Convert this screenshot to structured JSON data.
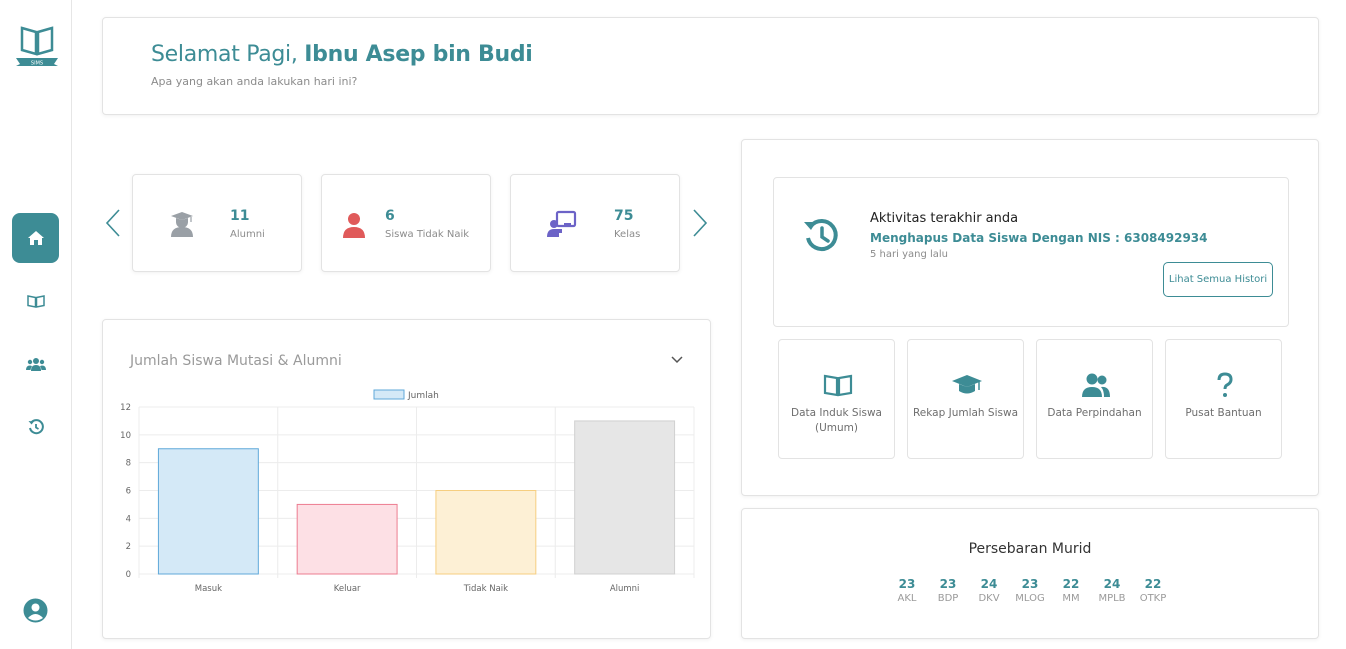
{
  "sidebar": {
    "logo_text": "SIMS",
    "items": [
      {
        "icon": "home-icon",
        "active": true
      },
      {
        "icon": "book-icon",
        "active": false
      },
      {
        "icon": "users-icon",
        "active": false
      },
      {
        "icon": "history-icon",
        "active": false
      }
    ],
    "profile_icon": "user-circle-icon"
  },
  "welcome": {
    "greeting": "Selamat Pagi, ",
    "name": "Ibnu Asep bin Budi",
    "subtitle": "Apa yang akan anda lakukan hari ini?"
  },
  "stats": [
    {
      "value": "11",
      "label": "Alumni",
      "icon": "graduate-icon",
      "color": "#9aa0a6"
    },
    {
      "value": "6",
      "label": "Siswa Tidak Naik",
      "icon": "user-icon",
      "color": "#e05a5a"
    },
    {
      "value": "75",
      "label": "Kelas",
      "icon": "classroom-icon",
      "color": "#6c63c7"
    }
  ],
  "chart_card": {
    "title": "Jumlah Siswa Mutasi & Alumni"
  },
  "chart_data": {
    "type": "bar",
    "categories": [
      "Masuk",
      "Keluar",
      "Tidak Naik",
      "Alumni"
    ],
    "series": [
      {
        "name": "Jumlah",
        "values": [
          9,
          5,
          6,
          11
        ]
      }
    ],
    "ylim": [
      0,
      12
    ],
    "yticks": [
      "0",
      "2",
      "4",
      "6",
      "8",
      "10",
      "12"
    ],
    "legend_position": "top",
    "grid": true,
    "colors": {
      "fills": [
        "#d4e9f7",
        "#fde0e5",
        "#fdf0d5",
        "#e6e6e6"
      ],
      "strokes": [
        "#5fa8d9",
        "#ec7c90",
        "#f6ce80",
        "#d0d0d0"
      ]
    }
  },
  "activity": {
    "title": "Aktivitas terakhir anda",
    "description": "Menghapus Data Siswa Dengan NIS : 6308492934",
    "time": "5 hari yang lalu",
    "button": "Lihat Semua Histori"
  },
  "menu": [
    {
      "label": "Data Induk Siswa (Umum)",
      "icon": "open-book-icon"
    },
    {
      "label": "Rekap Jumlah Siswa",
      "icon": "graduation-cap-icon"
    },
    {
      "label": "Data Perpindahan",
      "icon": "users-icon"
    },
    {
      "label": "Pusat Bantuan",
      "icon": "question-icon"
    }
  ],
  "spread": {
    "title": "Persebaran Murid",
    "items": [
      {
        "value": "23",
        "label": "AKL"
      },
      {
        "value": "23",
        "label": "BDP"
      },
      {
        "value": "24",
        "label": "DKV"
      },
      {
        "value": "23",
        "label": "MLOG"
      },
      {
        "value": "22",
        "label": "MM"
      },
      {
        "value": "24",
        "label": "MPLB"
      },
      {
        "value": "22",
        "label": "OTKP"
      }
    ]
  },
  "colors": {
    "accent": "#3d8c95"
  }
}
